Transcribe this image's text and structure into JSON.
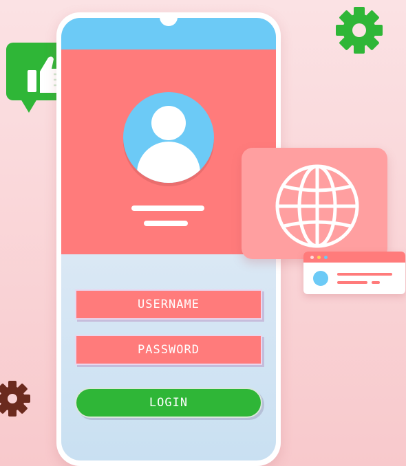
{
  "login_form": {
    "username_label": "USERNAME",
    "password_label": "PASSWORD",
    "login_label": "LOGIN"
  },
  "colors": {
    "background": "#f8c9cc",
    "panel_red": "#ff7b7b",
    "accent_blue": "#6ccaf6",
    "accent_green": "#2fb637",
    "gear_brown": "#6b2a1e"
  },
  "icons": [
    "thumbs-up-icon",
    "gear-icon",
    "globe-icon",
    "user-avatar-icon",
    "browser-window-icon"
  ]
}
